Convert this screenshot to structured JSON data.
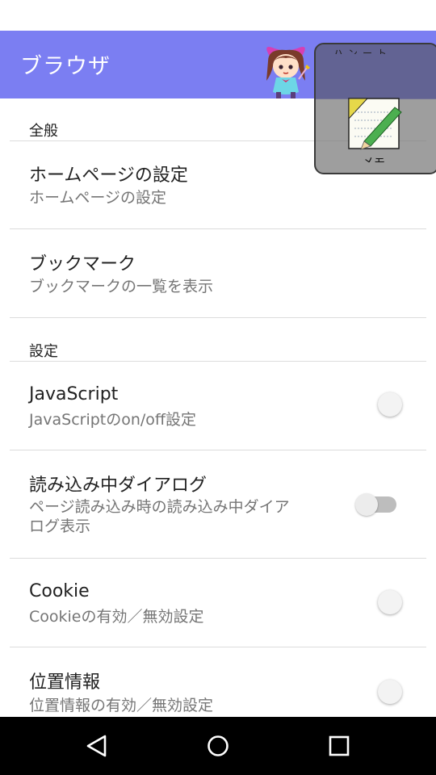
{
  "app_bar": {
    "title": "ブラウザ"
  },
  "overlay": {
    "top_text": "ハンート",
    "label": "メモ"
  },
  "sections": [
    {
      "header": "全般"
    },
    {
      "header": "設定"
    }
  ],
  "general_items": [
    {
      "title": "ホームページの設定",
      "summary": "ホームページの設定"
    },
    {
      "title": "ブックマーク",
      "summary": "ブックマークの一覧を表示"
    }
  ],
  "setting_items": [
    {
      "title": "JavaScript",
      "summary": "JavaScriptのon/off設定",
      "switch": "off"
    },
    {
      "title": "読み込み中ダイアログ",
      "summary_line1": "ページ読み込み時の読み込み中ダイア",
      "summary_line2": "ログ表示",
      "switch": "disabled"
    },
    {
      "title": "Cookie",
      "summary": "Cookieの有効／無効設定",
      "switch": "off"
    },
    {
      "title": "位置情報",
      "summary": "位置情報の有効／無効設定",
      "switch": "off"
    }
  ],
  "colors": {
    "app_bar": "#7b7ef2",
    "nav_bar": "#000000"
  },
  "nav": {
    "back": "back-icon",
    "home": "home-icon",
    "recents": "recents-icon"
  }
}
